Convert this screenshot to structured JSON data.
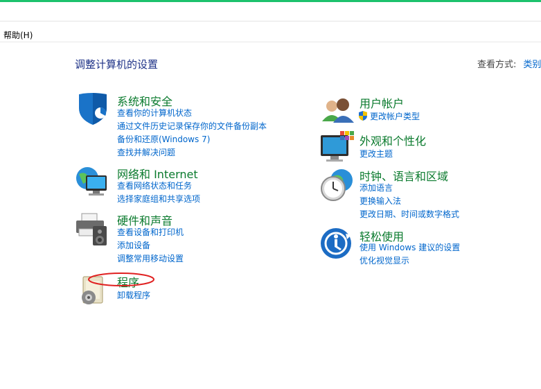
{
  "menu": {
    "help": "帮助(H)"
  },
  "header": {
    "title": "调整计算机的设置",
    "view_by_label": "查看方式:",
    "view_by_value": "类别"
  },
  "categories": {
    "security": {
      "title": "系统和安全",
      "links": [
        "查看你的计算机状态",
        "通过文件历史记录保存你的文件备份副本",
        "备份和还原(Windows 7)",
        "查找并解决问题"
      ]
    },
    "network": {
      "title": "网络和 Internet",
      "links": [
        "查看网络状态和任务",
        "选择家庭组和共享选项"
      ]
    },
    "hardware": {
      "title": "硬件和声音",
      "links": [
        "查看设备和打印机",
        "添加设备",
        "调整常用移动设置"
      ]
    },
    "programs": {
      "title": "程序",
      "links": [
        "卸载程序"
      ]
    },
    "users": {
      "title": "用户帐户",
      "links": [
        "更改帐户类型"
      ]
    },
    "appearance": {
      "title": "外观和个性化",
      "links": [
        "更改主题"
      ]
    },
    "clock": {
      "title": "时钟、语言和区域",
      "links": [
        "添加语言",
        "更换输入法",
        "更改日期、时间或数字格式"
      ]
    },
    "ease": {
      "title": "轻松使用",
      "links": [
        "使用 Windows 建议的设置",
        "优化视觉显示"
      ]
    }
  },
  "colors": {
    "category_title": "#0a7a2d",
    "link": "#0066cc",
    "page_title": "#1e3287",
    "annotation": "#e02020",
    "top_accent": "#1cc26d"
  },
  "icons": {
    "security": "shield-icon",
    "network": "network-globe-icon",
    "hardware": "printer-speaker-icon",
    "programs": "programs-disc-icon",
    "users": "users-icon",
    "appearance": "monitor-palette-icon",
    "clock": "clock-globe-icon",
    "ease": "ease-of-access-icon"
  }
}
